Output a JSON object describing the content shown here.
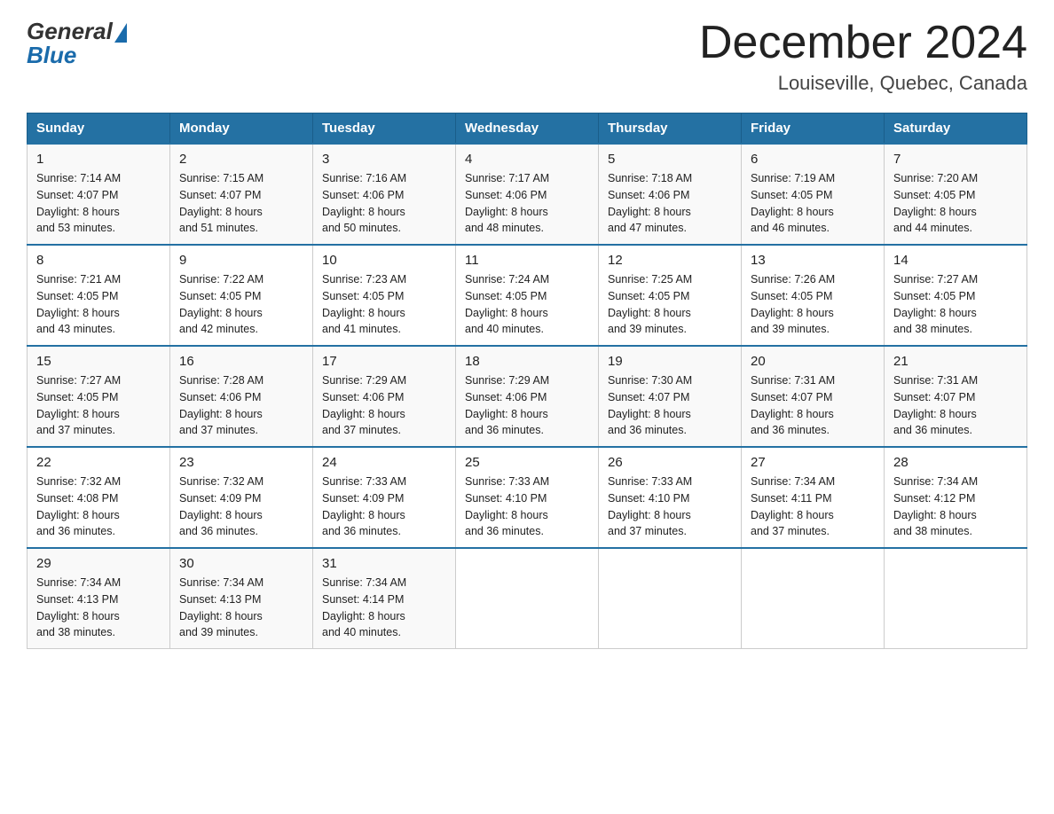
{
  "header": {
    "logo_general": "General",
    "logo_blue": "Blue",
    "month_title": "December 2024",
    "location": "Louiseville, Quebec, Canada"
  },
  "days_of_week": [
    "Sunday",
    "Monday",
    "Tuesday",
    "Wednesday",
    "Thursday",
    "Friday",
    "Saturday"
  ],
  "weeks": [
    [
      {
        "day": "1",
        "sunrise": "7:14 AM",
        "sunset": "4:07 PM",
        "daylight": "8 hours and 53 minutes."
      },
      {
        "day": "2",
        "sunrise": "7:15 AM",
        "sunset": "4:07 PM",
        "daylight": "8 hours and 51 minutes."
      },
      {
        "day": "3",
        "sunrise": "7:16 AM",
        "sunset": "4:06 PM",
        "daylight": "8 hours and 50 minutes."
      },
      {
        "day": "4",
        "sunrise": "7:17 AM",
        "sunset": "4:06 PM",
        "daylight": "8 hours and 48 minutes."
      },
      {
        "day": "5",
        "sunrise": "7:18 AM",
        "sunset": "4:06 PM",
        "daylight": "8 hours and 47 minutes."
      },
      {
        "day": "6",
        "sunrise": "7:19 AM",
        "sunset": "4:05 PM",
        "daylight": "8 hours and 46 minutes."
      },
      {
        "day": "7",
        "sunrise": "7:20 AM",
        "sunset": "4:05 PM",
        "daylight": "8 hours and 44 minutes."
      }
    ],
    [
      {
        "day": "8",
        "sunrise": "7:21 AM",
        "sunset": "4:05 PM",
        "daylight": "8 hours and 43 minutes."
      },
      {
        "day": "9",
        "sunrise": "7:22 AM",
        "sunset": "4:05 PM",
        "daylight": "8 hours and 42 minutes."
      },
      {
        "day": "10",
        "sunrise": "7:23 AM",
        "sunset": "4:05 PM",
        "daylight": "8 hours and 41 minutes."
      },
      {
        "day": "11",
        "sunrise": "7:24 AM",
        "sunset": "4:05 PM",
        "daylight": "8 hours and 40 minutes."
      },
      {
        "day": "12",
        "sunrise": "7:25 AM",
        "sunset": "4:05 PM",
        "daylight": "8 hours and 39 minutes."
      },
      {
        "day": "13",
        "sunrise": "7:26 AM",
        "sunset": "4:05 PM",
        "daylight": "8 hours and 39 minutes."
      },
      {
        "day": "14",
        "sunrise": "7:27 AM",
        "sunset": "4:05 PM",
        "daylight": "8 hours and 38 minutes."
      }
    ],
    [
      {
        "day": "15",
        "sunrise": "7:27 AM",
        "sunset": "4:05 PM",
        "daylight": "8 hours and 37 minutes."
      },
      {
        "day": "16",
        "sunrise": "7:28 AM",
        "sunset": "4:06 PM",
        "daylight": "8 hours and 37 minutes."
      },
      {
        "day": "17",
        "sunrise": "7:29 AM",
        "sunset": "4:06 PM",
        "daylight": "8 hours and 37 minutes."
      },
      {
        "day": "18",
        "sunrise": "7:29 AM",
        "sunset": "4:06 PM",
        "daylight": "8 hours and 36 minutes."
      },
      {
        "day": "19",
        "sunrise": "7:30 AM",
        "sunset": "4:07 PM",
        "daylight": "8 hours and 36 minutes."
      },
      {
        "day": "20",
        "sunrise": "7:31 AM",
        "sunset": "4:07 PM",
        "daylight": "8 hours and 36 minutes."
      },
      {
        "day": "21",
        "sunrise": "7:31 AM",
        "sunset": "4:07 PM",
        "daylight": "8 hours and 36 minutes."
      }
    ],
    [
      {
        "day": "22",
        "sunrise": "7:32 AM",
        "sunset": "4:08 PM",
        "daylight": "8 hours and 36 minutes."
      },
      {
        "day": "23",
        "sunrise": "7:32 AM",
        "sunset": "4:09 PM",
        "daylight": "8 hours and 36 minutes."
      },
      {
        "day": "24",
        "sunrise": "7:33 AM",
        "sunset": "4:09 PM",
        "daylight": "8 hours and 36 minutes."
      },
      {
        "day": "25",
        "sunrise": "7:33 AM",
        "sunset": "4:10 PM",
        "daylight": "8 hours and 36 minutes."
      },
      {
        "day": "26",
        "sunrise": "7:33 AM",
        "sunset": "4:10 PM",
        "daylight": "8 hours and 37 minutes."
      },
      {
        "day": "27",
        "sunrise": "7:34 AM",
        "sunset": "4:11 PM",
        "daylight": "8 hours and 37 minutes."
      },
      {
        "day": "28",
        "sunrise": "7:34 AM",
        "sunset": "4:12 PM",
        "daylight": "8 hours and 38 minutes."
      }
    ],
    [
      {
        "day": "29",
        "sunrise": "7:34 AM",
        "sunset": "4:13 PM",
        "daylight": "8 hours and 38 minutes."
      },
      {
        "day": "30",
        "sunrise": "7:34 AM",
        "sunset": "4:13 PM",
        "daylight": "8 hours and 39 minutes."
      },
      {
        "day": "31",
        "sunrise": "7:34 AM",
        "sunset": "4:14 PM",
        "daylight": "8 hours and 40 minutes."
      },
      null,
      null,
      null,
      null
    ]
  ],
  "labels": {
    "sunrise": "Sunrise:",
    "sunset": "Sunset:",
    "daylight": "Daylight:"
  }
}
